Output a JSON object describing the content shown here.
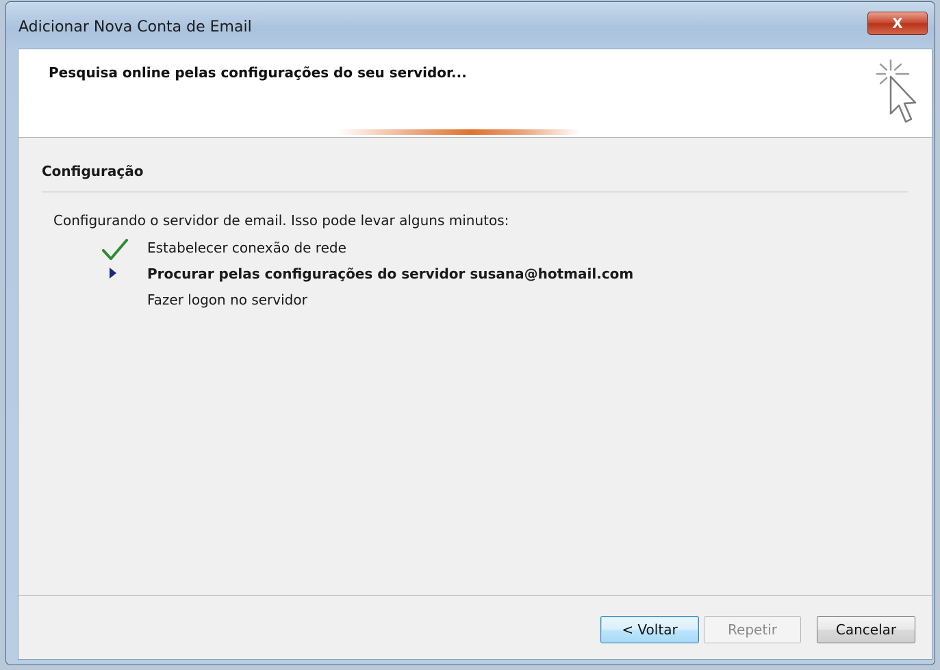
{
  "window": {
    "title": "Adicionar Nova Conta de Email",
    "close_label": "X"
  },
  "header": {
    "title": "Pesquisa online pelas configurações do seu servidor..."
  },
  "section": {
    "title": "Configuração",
    "intro": "Configurando o servidor de email. Isso pode levar alguns minutos:"
  },
  "steps": [
    {
      "label": "Estabelecer conexão de rede",
      "status": "done",
      "icon": "check-icon"
    },
    {
      "label": "Procurar pelas configurações do servidor susana@hotmail.com",
      "status": "in-progress",
      "icon": "arrow-icon"
    },
    {
      "label": "Fazer logon no servidor",
      "status": "pending"
    }
  ],
  "buttons": {
    "back": "< Voltar",
    "retry": "Repetir",
    "cancel": "Cancelar"
  },
  "colors": {
    "check": "#2e8b2e",
    "arrow": "#1a2a7a",
    "progress_accent": "#e0712f",
    "close_button": "#c7452c"
  }
}
